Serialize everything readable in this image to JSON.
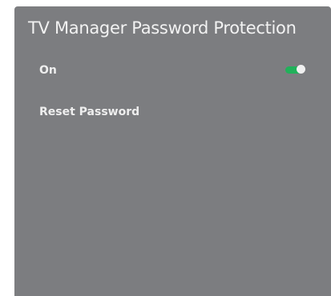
{
  "dialog": {
    "title": "TV Manager Password Protection"
  },
  "options": {
    "on": {
      "label": "On",
      "toggle_state": "on",
      "toggle_color": "#21b15a"
    },
    "reset_password": {
      "label": "Reset Password"
    }
  },
  "colors": {
    "panel_background": "#7c7d80",
    "text": "#eeeeee",
    "toggle_on": "#21b15a"
  }
}
